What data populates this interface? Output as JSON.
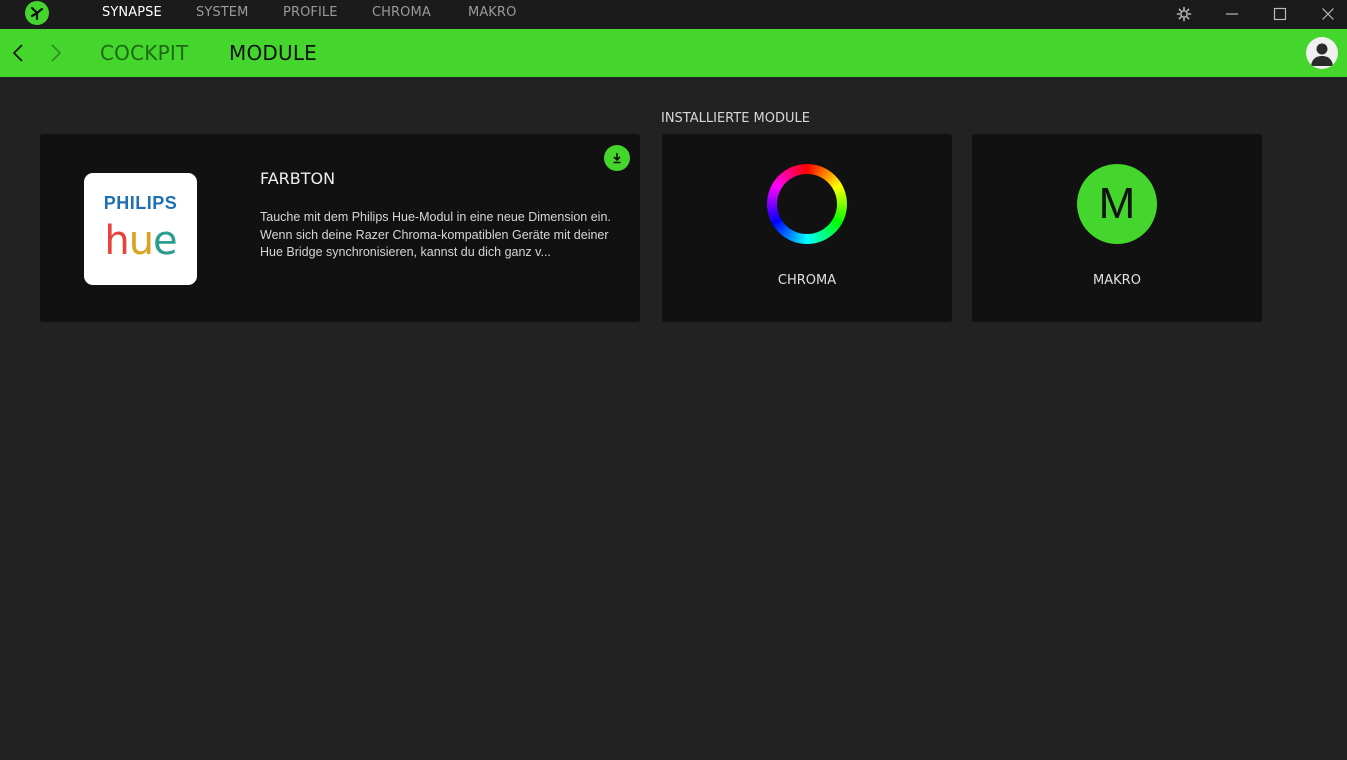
{
  "titlebar": {
    "tabs": [
      {
        "label": "SYNAPSE",
        "active": true
      },
      {
        "label": "SYSTEM",
        "active": false
      },
      {
        "label": "PROFILE",
        "active": false
      },
      {
        "label": "CHROMA",
        "active": false
      },
      {
        "label": "MAKRO",
        "active": false
      }
    ],
    "icons": [
      "razer-logo-icon",
      "settings-icon",
      "minimize-icon",
      "maximize-icon",
      "close-icon"
    ]
  },
  "navbar": {
    "tabs": [
      {
        "label": "COCKPIT",
        "active": false
      },
      {
        "label": "MODULE",
        "active": true
      }
    ],
    "icons": [
      "back-arrow-icon",
      "forward-arrow-icon",
      "user-avatar-icon"
    ]
  },
  "featured": {
    "logo_brand": "PHILIPS",
    "logo_word": "hue",
    "title": "FARBTON",
    "description": "Tauche mit dem Philips Hue-Modul in eine neue Dimension ein. Wenn sich deine Razer Chroma-kompatiblen Geräte mit deiner Hue Bridge synchronisieren, kannst du dich ganz v..."
  },
  "installed": {
    "section_title": "INSTALLIERTE MODULE",
    "modules": [
      {
        "label": "CHROMA",
        "icon": "chroma-ring-icon"
      },
      {
        "label": "MAKRO",
        "icon": "makro-icon",
        "letter": "M"
      }
    ]
  },
  "colors": {
    "accent": "#44d62c",
    "background": "#222222",
    "card": "#111111",
    "titlebar": "#1b1b1b"
  }
}
